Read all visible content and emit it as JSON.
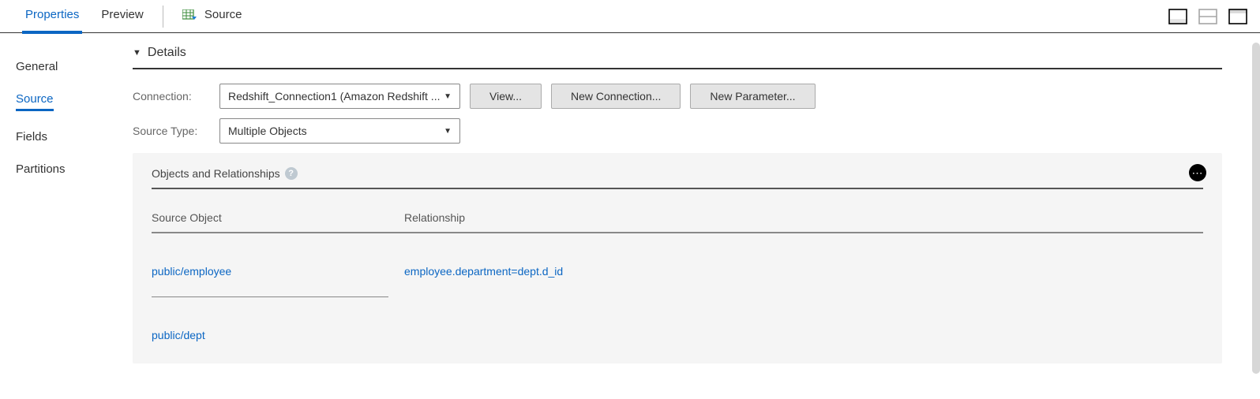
{
  "top_tabs": {
    "properties": "Properties",
    "preview": "Preview",
    "source": "Source"
  },
  "sidebar": {
    "items": [
      {
        "label": "General"
      },
      {
        "label": "Source"
      },
      {
        "label": "Fields"
      },
      {
        "label": "Partitions"
      }
    ]
  },
  "details": {
    "header": "Details",
    "connection_label": "Connection:",
    "connection_value": "Redshift_Connection1 (Amazon Redshift ...",
    "view_btn": "View...",
    "new_conn_btn": "New Connection...",
    "new_param_btn": "New Parameter...",
    "source_type_label": "Source Type:",
    "source_type_value": "Multiple Objects"
  },
  "objects_panel": {
    "title": "Objects and Relationships",
    "col_obj": "Source Object",
    "col_rel": "Relationship",
    "rows": [
      {
        "object": "public/employee",
        "relationship": "employee.department=dept.d_id"
      },
      {
        "object": "public/dept",
        "relationship": ""
      }
    ]
  }
}
